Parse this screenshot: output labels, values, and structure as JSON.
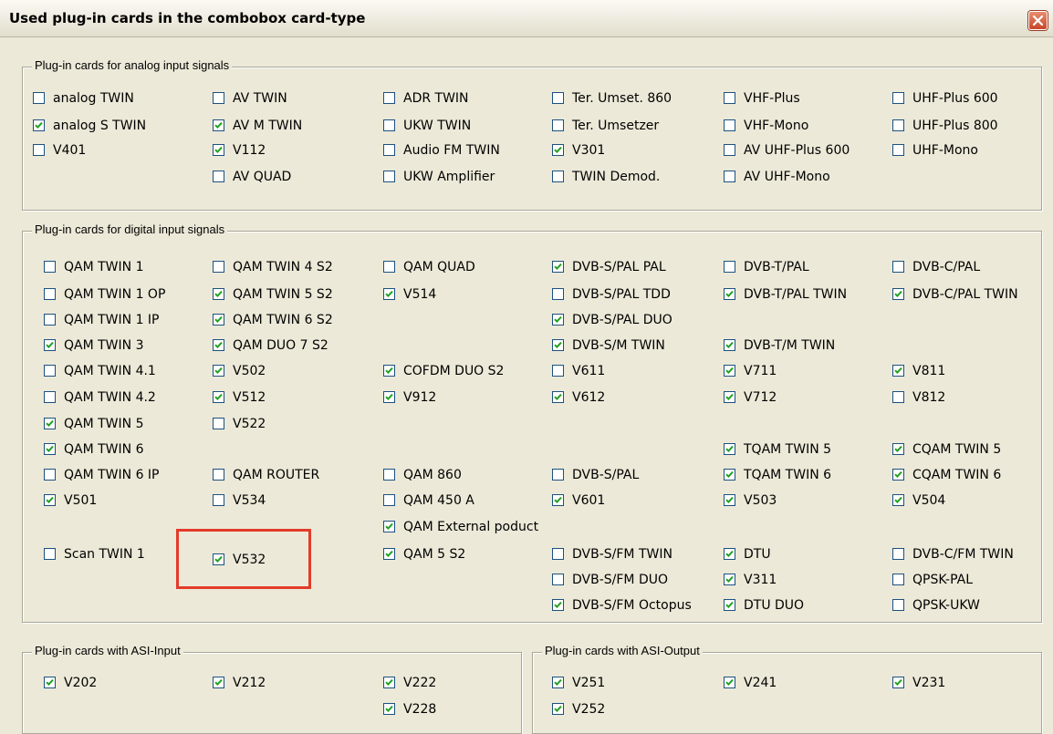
{
  "window": {
    "title": "Used plug-in cards in the combobox card-type"
  },
  "colors": {
    "dialog_bg": "#ECE9D8",
    "highlight": "#E33B2A",
    "checkbox_border": "#1C5180",
    "close_button": "#C8462A"
  },
  "icons": {
    "close": "close-icon",
    "check": "checkmark-icon"
  },
  "groups": [
    {
      "id": "analog",
      "label": "Plug-in cards for analog input signals",
      "items": [
        {
          "label": "analog TWIN",
          "checked": false
        },
        {
          "label": "analog S TWIN",
          "checked": true
        },
        {
          "label": "V401",
          "checked": false
        },
        {
          "label": "AV TWIN",
          "checked": false
        },
        {
          "label": "AV M TWIN",
          "checked": true
        },
        {
          "label": "V112",
          "checked": true
        },
        {
          "label": "AV QUAD",
          "checked": false
        },
        {
          "label": "ADR TWIN",
          "checked": false
        },
        {
          "label": "UKW TWIN",
          "checked": false
        },
        {
          "label": "Audio FM TWIN",
          "checked": false
        },
        {
          "label": "UKW Amplifier",
          "checked": false
        },
        {
          "label": "Ter. Umset. 860",
          "checked": false
        },
        {
          "label": "Ter. Umsetzer",
          "checked": false
        },
        {
          "label": "V301",
          "checked": true
        },
        {
          "label": "TWIN Demod.",
          "checked": false
        },
        {
          "label": "VHF-Plus",
          "checked": false
        },
        {
          "label": "VHF-Mono",
          "checked": false
        },
        {
          "label": "AV UHF-Plus 600",
          "checked": false
        },
        {
          "label": "AV UHF-Mono",
          "checked": false
        },
        {
          "label": "UHF-Plus 600",
          "checked": false
        },
        {
          "label": "UHF-Plus 800",
          "checked": false
        },
        {
          "label": "UHF-Mono",
          "checked": false
        }
      ]
    },
    {
      "id": "digital",
      "label": "Plug-in cards for digital input signals",
      "items": [
        {
          "label": "QAM TWIN 1",
          "checked": false
        },
        {
          "label": "QAM TWIN 1 OP",
          "checked": false
        },
        {
          "label": "QAM TWIN 1 IP",
          "checked": false
        },
        {
          "label": "QAM TWIN 3",
          "checked": true
        },
        {
          "label": "QAM TWIN 4.1",
          "checked": false
        },
        {
          "label": "QAM TWIN 4.2",
          "checked": false
        },
        {
          "label": "QAM TWIN 5",
          "checked": true
        },
        {
          "label": "QAM TWIN 6",
          "checked": true
        },
        {
          "label": "QAM TWIN 6 IP",
          "checked": false
        },
        {
          "label": "V501",
          "checked": true
        },
        {
          "label": "Scan TWIN 1",
          "checked": false
        },
        {
          "label": "QAM TWIN 4 S2",
          "checked": false
        },
        {
          "label": "QAM TWIN 5 S2",
          "checked": true
        },
        {
          "label": "QAM TWIN 6 S2",
          "checked": true
        },
        {
          "label": "QAM DUO 7 S2",
          "checked": true
        },
        {
          "label": "V502",
          "checked": true
        },
        {
          "label": "V512",
          "checked": true
        },
        {
          "label": "V522",
          "checked": false
        },
        {
          "label": "QAM ROUTER",
          "checked": false
        },
        {
          "label": "V534",
          "checked": false
        },
        {
          "label": "V532",
          "checked": true
        },
        {
          "label": "QAM QUAD",
          "checked": false
        },
        {
          "label": "V514",
          "checked": true
        },
        {
          "label": "COFDM DUO S2",
          "checked": true
        },
        {
          "label": "V912",
          "checked": true
        },
        {
          "label": "QAM 860",
          "checked": false
        },
        {
          "label": "QAM 450 A",
          "checked": false
        },
        {
          "label": "QAM External poduct",
          "checked": true
        },
        {
          "label": "QAM 5 S2",
          "checked": true
        },
        {
          "label": "DVB-S/PAL PAL",
          "checked": true
        },
        {
          "label": "DVB-S/PAL TDD",
          "checked": false
        },
        {
          "label": "DVB-S/PAL DUO",
          "checked": true
        },
        {
          "label": "DVB-S/M TWIN",
          "checked": true
        },
        {
          "label": "V611",
          "checked": false
        },
        {
          "label": "V612",
          "checked": true
        },
        {
          "label": "DVB-S/PAL",
          "checked": false
        },
        {
          "label": "V601",
          "checked": true
        },
        {
          "label": "DVB-S/FM TWIN",
          "checked": false
        },
        {
          "label": "DVB-S/FM DUO",
          "checked": false
        },
        {
          "label": "DVB-S/FM Octopus",
          "checked": true
        },
        {
          "label": "DVB-T/PAL",
          "checked": false
        },
        {
          "label": "DVB-T/PAL TWIN",
          "checked": true
        },
        {
          "label": "DVB-T/M TWIN",
          "checked": true
        },
        {
          "label": "V711",
          "checked": true
        },
        {
          "label": "V712",
          "checked": true
        },
        {
          "label": "TQAM TWIN 5",
          "checked": true
        },
        {
          "label": "TQAM TWIN 6",
          "checked": true
        },
        {
          "label": "V503",
          "checked": true
        },
        {
          "label": "DTU",
          "checked": true
        },
        {
          "label": "V311",
          "checked": true
        },
        {
          "label": "DTU DUO",
          "checked": true
        },
        {
          "label": "DVB-C/PAL",
          "checked": false
        },
        {
          "label": "DVB-C/PAL TWIN",
          "checked": true
        },
        {
          "label": "V811",
          "checked": true
        },
        {
          "label": "V812",
          "checked": false
        },
        {
          "label": "CQAM TWIN 5",
          "checked": true
        },
        {
          "label": "CQAM TWIN 6",
          "checked": true
        },
        {
          "label": "V504",
          "checked": true
        },
        {
          "label": "DVB-C/FM TWIN",
          "checked": false
        },
        {
          "label": "QPSK-PAL",
          "checked": false
        },
        {
          "label": "QPSK-UKW",
          "checked": false
        }
      ]
    },
    {
      "id": "asi_input",
      "label": "Plug-in cards with ASI-Input",
      "items": [
        {
          "label": "V202",
          "checked": true
        },
        {
          "label": "V212",
          "checked": true
        },
        {
          "label": "V222",
          "checked": true
        },
        {
          "label": "V228",
          "checked": true
        }
      ]
    },
    {
      "id": "asi_output",
      "label": "Plug-in cards with ASI-Output",
      "items": [
        {
          "label": "V251",
          "checked": true
        },
        {
          "label": "V252",
          "checked": true
        },
        {
          "label": "V241",
          "checked": true
        },
        {
          "label": "V231",
          "checked": true
        }
      ]
    }
  ]
}
